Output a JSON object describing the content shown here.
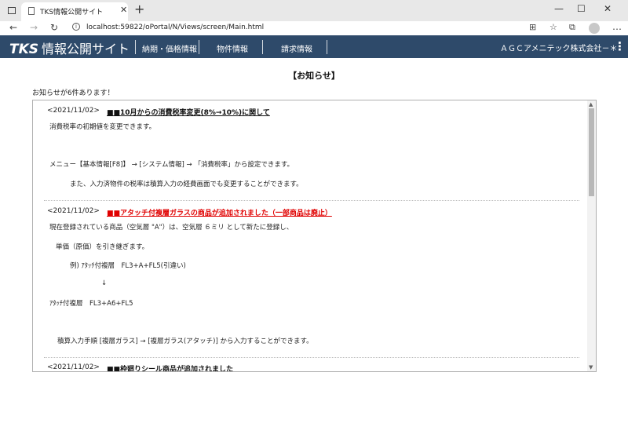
{
  "browser": {
    "tab_title": "TKS情報公開サイト",
    "url": "localhost:59822/oPortal/N/Views/screen/Main.html"
  },
  "site": {
    "logo_latin": "TKS",
    "logo_jp": "情報公開サイト",
    "nav": [
      "納期・価格情報",
      "物件情報",
      "請求情報"
    ],
    "company": "ＡＧＣアメニテック株式会社－＊"
  },
  "page": {
    "heading": "【お知らせ】",
    "count_text": "お知らせが6件あります！"
  },
  "news": [
    {
      "date": "<2021/11/02>",
      "title": "■■10月からの消費税率変更(8%→10%)に関して",
      "title_color": "#111111",
      "lines": [
        "消費税率の初期値を変更できます。",
        "メニュー【基本情報[F8]】 → [システム情報] → 「消費税率」から設定できます。",
        "また、入力済物件の税率は積算入力の経費画面でも変更することができます。"
      ]
    },
    {
      "date": "<2021/11/02>",
      "title": "■■アタッチ付複層ガラスの商品が追加されました（一部商品は廃止）",
      "title_color": "#e00000",
      "lines": [
        "現在登録されている商品（空気層 \"A\"）は、空気層 ６ミリ として新たに登録し、",
        "単価（原価）を引き継ぎます。",
        "例) ｱﾀｯﾁ付複層　FL3+A+FL5(引違い)",
        "↓",
        "ｱﾀｯﾁ付複層　FL3+A6+FL5",
        "積算入力手順 [複層ガラス] → [複層ガラス(アタッチ)] から入力することができます。"
      ]
    },
    {
      "date": "<2021/11/02>",
      "title": "■■枠廻りシール商品が追加されました",
      "title_color": "#111111",
      "lines": []
    }
  ]
}
